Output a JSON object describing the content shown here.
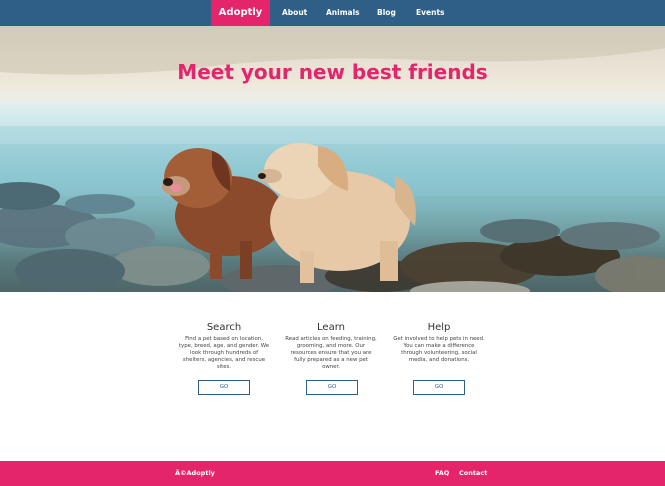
{
  "nav": {
    "brand": "Adoptly",
    "links": [
      "About",
      "Animals",
      "Blog",
      "Events"
    ]
  },
  "hero": {
    "title": "Meet your new best friends"
  },
  "features": [
    {
      "title": "Search",
      "text": "Find a pet based on location, type, breed, age, and gender. We look through hundreds of shelters, agencies, and rescue sites.",
      "button": "GO"
    },
    {
      "title": "Learn",
      "text": "Read articles on feeding, training, grooming, and more. Our resources ensure that you are fully prepared as a new pet owner.",
      "button": "GO"
    },
    {
      "title": "Help",
      "text": "Get involved to help pets in need. You can make a difference through volunteering, social media, and donations.",
      "button": "GO"
    }
  ],
  "footer": {
    "brand": "Â©Adoptly",
    "links": [
      "FAQ",
      "Contact"
    ]
  },
  "colors": {
    "accent": "#e5256b",
    "nav_bg": "#2f5f86"
  }
}
